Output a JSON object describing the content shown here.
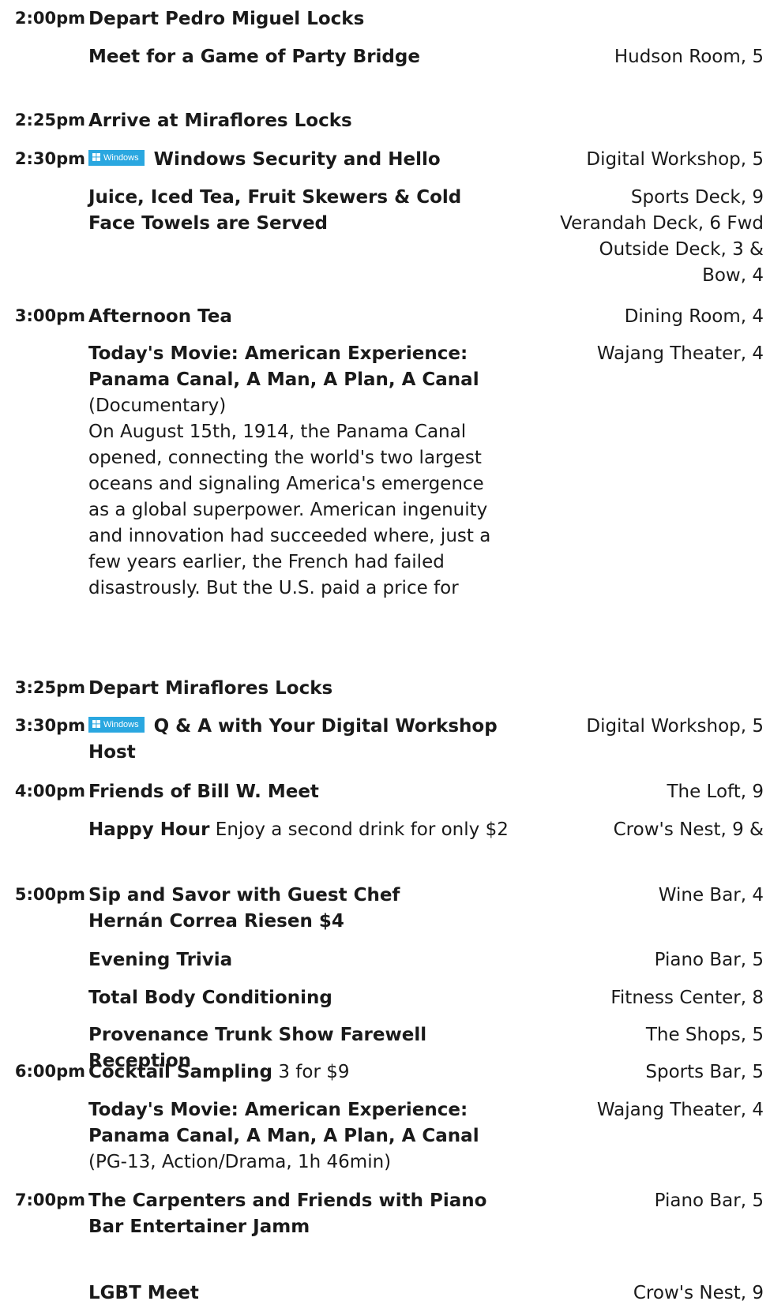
{
  "windows_badge": {
    "label": "Windows",
    "icon": "windows-logo-icon",
    "color": "#2aa7e0"
  },
  "entries": [
    {
      "time": "2:00pm",
      "title": "Depart Pedro Miguel Locks",
      "location": ""
    },
    {
      "time": "",
      "title": "Meet for a Game of Party Bridge",
      "location": "Hudson Room, 5"
    },
    {
      "time": "2:25pm",
      "title": "Arrive at Miraflores Locks",
      "location": ""
    },
    {
      "time": "2:30pm",
      "title": "Windows Security and Hello",
      "badge": true,
      "location": "Digital Workshop, 5"
    },
    {
      "time": "",
      "title": "Juice, Iced Tea, Fruit Skewers & Cold Face Towels are Served",
      "location_lines": [
        "Sports Deck, 9",
        "Verandah Deck, 6 Fwd",
        "Outside Deck, 3 &",
        "Bow, 4"
      ]
    },
    {
      "time": "3:00pm",
      "title": "Afternoon Tea",
      "location": "Dining Room, 4"
    },
    {
      "time": "",
      "title": "Today's Movie: American Experience: Panama Canal, A Man, A Plan, A Canal",
      "subtitle": "(Documentary)",
      "description": "On August 15th, 1914, the Panama Canal opened, connecting the world's two largest oceans and signaling America's emergence as a global superpower. American ingenuity and innovation had succeeded where, just a few years earlier, the French had failed disastrously. But the U.S. paid a price for",
      "location": "Wajang Theater, 4"
    },
    {
      "time": "3:25pm",
      "title": "Depart Miraflores Locks",
      "location": ""
    },
    {
      "time": "3:30pm",
      "title": "Q & A with Your Digital Workshop Host",
      "badge": true,
      "location": "Digital Workshop, 5"
    },
    {
      "time": "4:00pm",
      "title": "Friends of Bill W. Meet",
      "location": "The Loft, 9"
    },
    {
      "time": "",
      "title": "Happy Hour",
      "note": "Enjoy a second drink for only $2",
      "location": "Crow's Nest, 9 &"
    },
    {
      "time": "5:00pm",
      "title": "Sip and Savor with Guest Chef Hernán Correa Riesen $4",
      "location": "Wine Bar, 4"
    },
    {
      "time": "",
      "title": "Evening Trivia",
      "location": "Piano Bar, 5"
    },
    {
      "time": "",
      "title": "Total Body Conditioning",
      "location": "Fitness Center, 8"
    },
    {
      "time": "",
      "title": "Provenance Trunk Show Farewell Reception",
      "location": "The Shops, 5"
    },
    {
      "time": "6:00pm",
      "title": "Cocktail Sampling",
      "note": "3 for $9",
      "location": "Sports Bar, 5"
    },
    {
      "time": "",
      "title": "Today's Movie: American Experience: Panama Canal, A Man, A Plan, A Canal",
      "subtitle": "(PG-13, Action/Drama, 1h 46min)",
      "location": "Wajang Theater, 4"
    },
    {
      "time": "7:00pm",
      "title": "The Carpenters and Friends with Piano Bar Entertainer Jamm",
      "location": "Piano Bar, 5"
    },
    {
      "time": "",
      "title": "LGBT Meet",
      "location": "Crow's Nest, 9"
    }
  ]
}
